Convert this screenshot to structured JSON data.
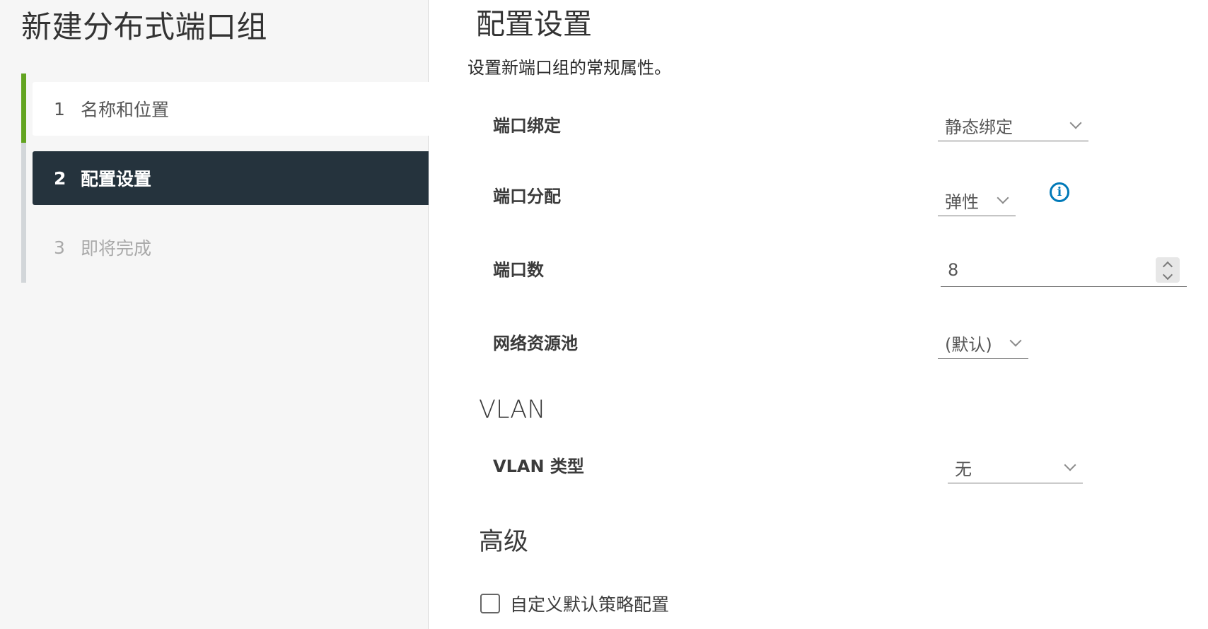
{
  "wizard": {
    "title": "新建分布式端口组",
    "steps": [
      {
        "number": "1",
        "label": "名称和位置",
        "state": "completed"
      },
      {
        "number": "2",
        "label": "配置设置",
        "state": "active"
      },
      {
        "number": "3",
        "label": "即将完成",
        "state": "pending"
      }
    ]
  },
  "main": {
    "title": "配置设置",
    "subtitle": "设置新端口组的常规属性。",
    "fields": {
      "port_binding": {
        "label": "端口绑定",
        "value": "静态绑定"
      },
      "port_allocation": {
        "label": "端口分配",
        "value": "弹性",
        "info_icon": "info-icon"
      },
      "num_ports": {
        "label": "端口数",
        "value": "8"
      },
      "network_resource_pool": {
        "label": "网络资源池",
        "value": "(默认)"
      }
    },
    "vlan_section": {
      "heading": "VLAN",
      "vlan_type": {
        "label": "VLAN 类型",
        "value": "无"
      }
    },
    "advanced_section": {
      "heading": "高级",
      "customize_policy": {
        "label": "自定义默认策略配置",
        "checked": false
      }
    }
  },
  "colors": {
    "active_step_bg": "#25333d",
    "completed_indicator": "#62a420",
    "info_icon": "#0079b8"
  }
}
